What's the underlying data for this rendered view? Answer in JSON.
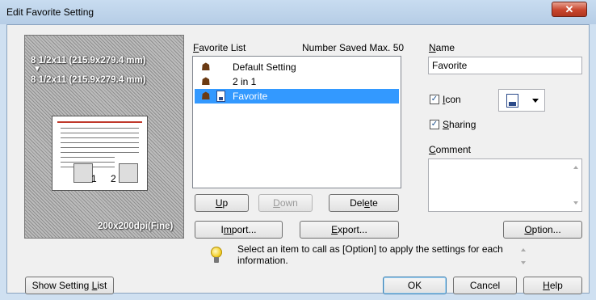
{
  "window": {
    "title": "Edit Favorite Setting",
    "close_symbol": "✕"
  },
  "preview": {
    "paper_line1": "8 1/2x11 (215.9x279.4 mm)",
    "arrow": "▼",
    "paper_line2": "8 1/2x11 (215.9x279.4 mm)",
    "page1": "1",
    "page2": "2",
    "resolution": "200x200dpi(Fine)"
  },
  "favorite_list": {
    "label_pre": "",
    "label_key": "F",
    "label_post": "avorite List",
    "max_label": "Number Saved Max. 50",
    "items": [
      {
        "label": "Default Setting"
      },
      {
        "label": "2 in 1"
      },
      {
        "label": "Favorite"
      }
    ],
    "selected_index": 2
  },
  "list_buttons": {
    "up_key": "U",
    "up_rest": "p",
    "down_key": "D",
    "down_rest": "own",
    "delete_pre": "Del",
    "delete_key": "e",
    "delete_post": "te",
    "import_pre": "I",
    "import_key": "m",
    "import_post": "port...",
    "export_key": "E",
    "export_rest": "xport..."
  },
  "name": {
    "label_key": "N",
    "label_rest": "ame",
    "value": "Favorite"
  },
  "icon": {
    "label_key": "I",
    "label_rest": "con",
    "checked": true
  },
  "sharing": {
    "label_key": "S",
    "label_rest": "haring",
    "checked": true
  },
  "comment": {
    "label_key": "C",
    "label_rest": "omment",
    "value": ""
  },
  "option_button": {
    "key": "O",
    "rest": "ption..."
  },
  "info": {
    "text": "Select an item to call as [Option] to apply the settings for each information."
  },
  "footer": {
    "show_setting_pre": "Show Setting ",
    "show_setting_key": "L",
    "show_setting_post": "ist",
    "ok": "OK",
    "cancel": "Cancel",
    "help_key": "H",
    "help_rest": "elp"
  },
  "colors": {
    "selection": "#3399ff",
    "window_frame": "#cfe0f1",
    "client_bg": "#f0f0f0"
  }
}
